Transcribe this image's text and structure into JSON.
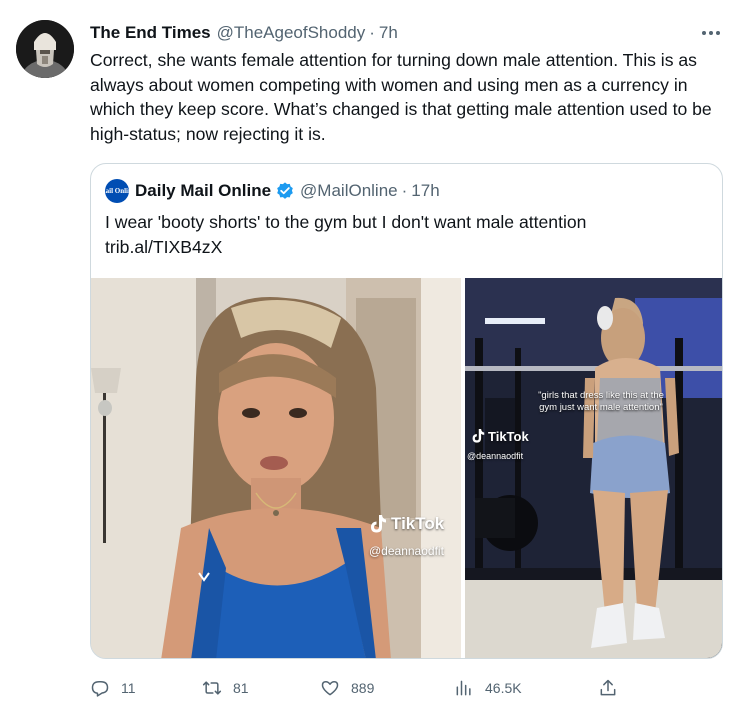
{
  "tweet": {
    "author_name": "The End Times",
    "author_handle": "@TheAgeofShoddy",
    "separator": "·",
    "time": "7h",
    "text": "Correct, she wants female attention for turning down male attention. This is as always about women competing with women and using men as a currency in which they keep score. What’s changed is that getting male attention used to be high-status; now rejecting it is."
  },
  "quote": {
    "logo_text": "Mail Online",
    "author_name": "Daily Mail Online",
    "author_handle": "@MailOnline",
    "separator": "·",
    "time": "17h",
    "text": "I wear 'booty shorts' to the gym but I don't want male attention",
    "link": "trib.al/TIXB4zX",
    "media_left": {
      "tiktok_label": "TikTok",
      "tiktok_user": "@deannaodfit"
    },
    "media_right": {
      "caption": "\"girls that dress like this at the gym just want male attention\"",
      "tiktok_label": "TikTok",
      "tiktok_user": "@deannaodfit"
    }
  },
  "actions": {
    "replies": "11",
    "retweets": "81",
    "likes": "889",
    "views": "46.5K"
  },
  "colors": {
    "text": "#0f1419",
    "secondary": "#536471",
    "border": "#cfd9de",
    "verified": "#1d9bf0",
    "mail_logo": "#004db3"
  },
  "icons": {
    "more": "more-icon",
    "reply": "reply-icon",
    "retweet": "retweet-icon",
    "like": "heart-icon",
    "views": "views-icon",
    "share": "share-icon",
    "verified": "verified-badge-icon",
    "tiktok": "tiktok-icon"
  }
}
